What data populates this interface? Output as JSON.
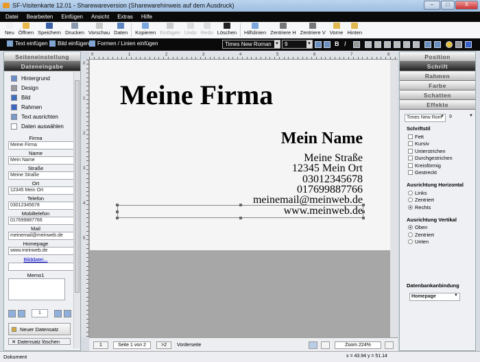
{
  "window": {
    "title": "SF-Visitenkarte 12.01 - Shareware​version (Sharewarehinweis auf dem Ausdruck)",
    "min": "–",
    "max": "□",
    "close": "X"
  },
  "menu": [
    "Datei",
    "Bearbeiten",
    "Einfügen",
    "Ansicht",
    "Extras",
    "Hilfe"
  ],
  "toolbar": [
    {
      "label": "Neu",
      "color": "#f1f1f1"
    },
    {
      "label": "Öffnen",
      "color": "#e8b94a"
    },
    {
      "label": "Speichern",
      "color": "#3b62a8"
    },
    {
      "label": "Drucken",
      "color": "#8a99ad"
    },
    {
      "label": "Vorschau",
      "color": "#c9c9c9"
    },
    {
      "label": "Daten",
      "color": "#5e86c1"
    },
    {
      "label": "Kopieren",
      "color": "#7aa7dd"
    },
    {
      "label": "Einfügen",
      "color": "#ccc",
      "disabled": true
    },
    {
      "label": "Undo",
      "color": "#ddd",
      "disabled": true
    },
    {
      "label": "Redo",
      "color": "#ddd",
      "disabled": true
    },
    {
      "label": "Löschen",
      "color": "#222"
    },
    {
      "label": "Hilfslinien",
      "color": "#7aa7dd"
    },
    {
      "label": "Zentriere H",
      "color": "#777"
    },
    {
      "label": "Zentriere V",
      "color": "#777"
    },
    {
      "label": "Vorne",
      "color": "#e0b84e"
    },
    {
      "label": "Hinten",
      "color": "#e0b84e"
    }
  ],
  "format": {
    "text_insert": "Text einfügen",
    "image_insert": "Bild einfügen",
    "shapes_insert": "Formen / Linien einfügen",
    "font": "Times New Roman",
    "size": "9"
  },
  "left": {
    "tab1": "Seiteneinstellung",
    "tab2": "Dateneingabe",
    "nav": [
      "Hintergrund",
      "Design",
      "Bild",
      "Rahmen",
      "Text ausrichten",
      "Daten auswählen"
    ],
    "fields": [
      {
        "label": "Firma",
        "value": "Meine Firma"
      },
      {
        "label": "Name",
        "value": "Mein Name"
      },
      {
        "label": "Straße",
        "value": "Meine Straße"
      },
      {
        "label": "Ort",
        "value": "12345 Mein Ort"
      },
      {
        "label": "Telefon",
        "value": "03012345678"
      },
      {
        "label": "Mobiltelefon",
        "value": "017699887766"
      },
      {
        "label": "Mail",
        "value": "meinemail@meinweb.de"
      },
      {
        "label": "Homepage",
        "value": "www.meinweb.de"
      }
    ],
    "image_link": "Bilddatei...",
    "image_value": "",
    "memo_label": "Memo1",
    "memo_value": "",
    "record": "1",
    "new_record": "Neuer Datensatz",
    "delete_record": "Datensatz löschen"
  },
  "ruler": {
    "h": [
      "0",
      "1",
      "2",
      "3",
      "4",
      "5",
      "6",
      "7",
      "8"
    ],
    "v": [
      "0",
      "1",
      "2",
      "3",
      "4",
      "5"
    ]
  },
  "card": {
    "company": "Meine Firma",
    "name": "Mein Name",
    "lines": [
      "Meine Straße",
      "12345 Mein Ort",
      "03012345678",
      "017699887766",
      "meinemail@meinweb.de",
      "www.meinweb.de"
    ]
  },
  "bottom": {
    "first": "1",
    "page": "Seite 1 von 2",
    "next": ">2",
    "side": "Vorderseite",
    "zoom": "Zoom 224%"
  },
  "right": {
    "tabs": [
      "Position",
      "Schrift",
      "Rahmen",
      "Farbe",
      "Schatten",
      "Effekte"
    ],
    "font": "Times New Rom",
    "size": "9",
    "style_title": "Schriftstil",
    "styles": [
      "Fett",
      "Kursiv",
      "Unterstrichen",
      "Durchgestrichen",
      "Kreisförmig",
      "Gestreckt"
    ],
    "h_title": "Ausrichtung Horizontal",
    "h_opts": [
      "Links",
      "Zentriert",
      "Rechts"
    ],
    "h_selected": 2,
    "v_title": "Ausrichtung Vertikal",
    "v_opts": [
      "Oben",
      "Zentriert",
      "Unten"
    ],
    "v_selected": 0,
    "db_title": "Datenbankanbindung",
    "db_value": "Homepage"
  },
  "status": {
    "left": "Dokument",
    "coords": "x = 43.94  y = 51.14"
  }
}
